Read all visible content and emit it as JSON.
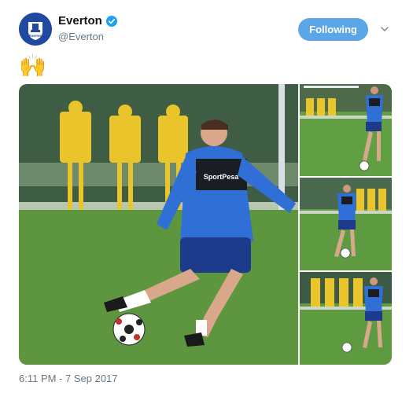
{
  "account": {
    "display_name": "Everton",
    "handle": "@Everton",
    "verified": true,
    "avatar_icon": "everton-crest-icon",
    "avatar_text": "Everton"
  },
  "follow_button": {
    "label": "Following"
  },
  "tweet": {
    "text": "🙌",
    "timestamp": "6:11 PM - 7 Sep 2017"
  },
  "media": {
    "main_photo": {
      "sponsor_text": "SportPesa"
    },
    "photo_count": 4
  },
  "colors": {
    "accent": "#5aa6e6",
    "verified": "#1da1f2",
    "kit_blue": "#2f6fd6",
    "pitch_green": "#5a8f3c",
    "mannequin_yellow": "#e9c42b"
  }
}
